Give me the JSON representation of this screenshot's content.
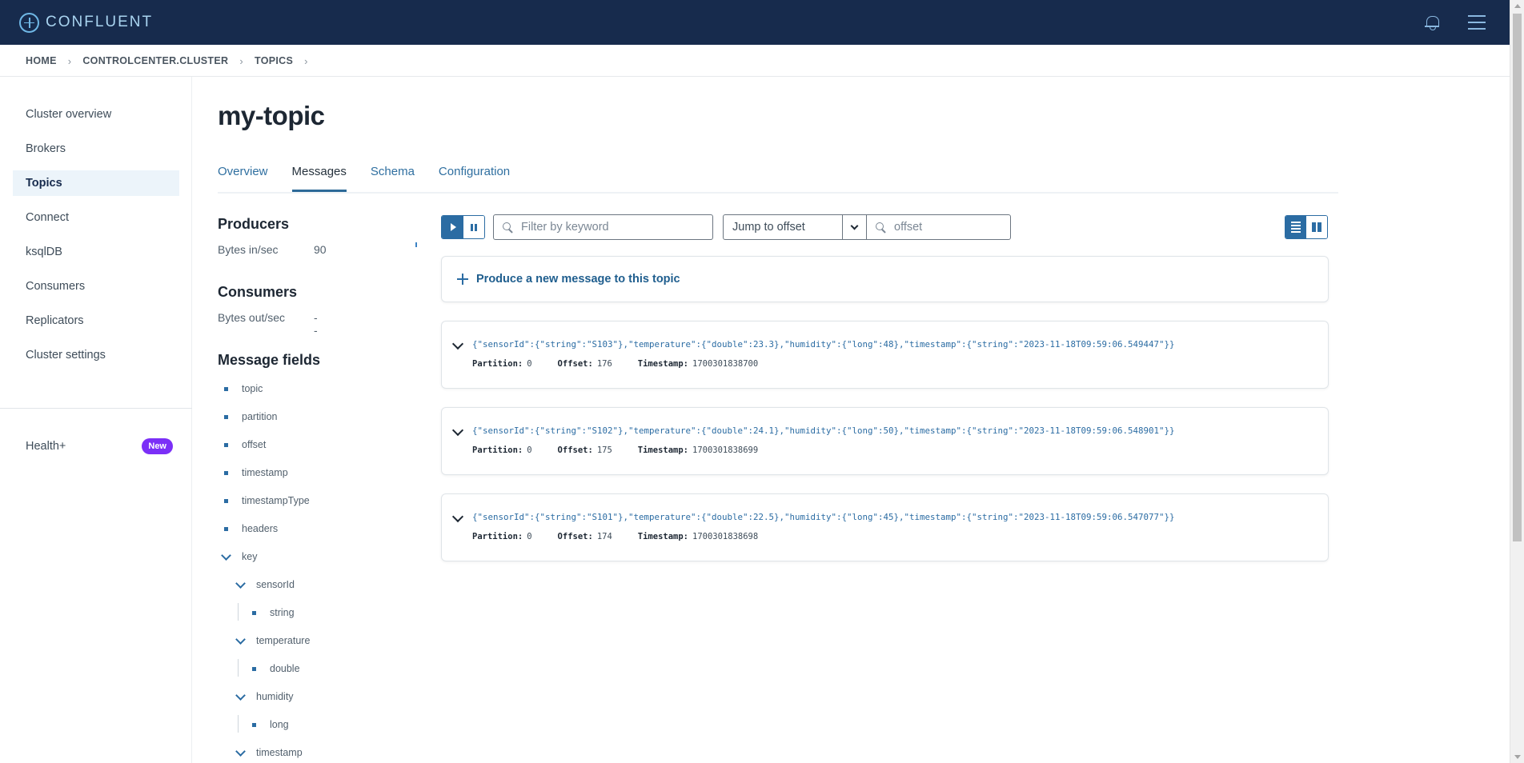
{
  "header": {
    "brand": "CONFLUENT"
  },
  "breadcrumb": [
    "HOME",
    "CONTROLCENTER.CLUSTER",
    "TOPICS"
  ],
  "sidebar": {
    "items": [
      {
        "label": "Cluster overview",
        "active": false
      },
      {
        "label": "Brokers",
        "active": false
      },
      {
        "label": "Topics",
        "active": true
      },
      {
        "label": "Connect",
        "active": false
      },
      {
        "label": "ksqlDB",
        "active": false
      },
      {
        "label": "Consumers",
        "active": false
      },
      {
        "label": "Replicators",
        "active": false
      },
      {
        "label": "Cluster settings",
        "active": false
      }
    ],
    "health_label": "Health+",
    "health_badge": "New"
  },
  "page": {
    "title": "my-topic",
    "tabs": [
      {
        "label": "Overview",
        "active": false
      },
      {
        "label": "Messages",
        "active": true
      },
      {
        "label": "Schema",
        "active": false
      },
      {
        "label": "Configuration",
        "active": false
      }
    ]
  },
  "producers": {
    "heading": "Producers",
    "metric_label": "Bytes in/sec",
    "metric_value": "90"
  },
  "consumers": {
    "heading": "Consumers",
    "metric_label": "Bytes out/sec",
    "metric_value": "--"
  },
  "message_fields": {
    "heading": "Message fields",
    "top_fields": [
      "topic",
      "partition",
      "offset",
      "timestamp",
      "timestampType",
      "headers"
    ],
    "key_label": "key",
    "key_fields": [
      {
        "name": "sensorId",
        "type": "string"
      },
      {
        "name": "temperature",
        "type": "double"
      },
      {
        "name": "humidity",
        "type": "long"
      },
      {
        "name": "timestamp",
        "type": ""
      }
    ]
  },
  "toolbar": {
    "filter_placeholder": "Filter by keyword",
    "jump_select": "Jump to offset",
    "offset_placeholder": "offset"
  },
  "produce": {
    "label": "Produce a new message to this topic"
  },
  "messages": [
    {
      "value": "{\"sensorId\":{\"string\":\"S103\"},\"temperature\":{\"double\":23.3},\"humidity\":{\"long\":48},\"timestamp\":{\"string\":\"2023-11-18T09:59:06.549447\"}}",
      "partition_label": "Partition:",
      "partition": "0",
      "offset_label": "Offset:",
      "offset": "176",
      "timestamp_label": "Timestamp:",
      "timestamp": "1700301838700"
    },
    {
      "value": "{\"sensorId\":{\"string\":\"S102\"},\"temperature\":{\"double\":24.1},\"humidity\":{\"long\":50},\"timestamp\":{\"string\":\"2023-11-18T09:59:06.548901\"}}",
      "partition_label": "Partition:",
      "partition": "0",
      "offset_label": "Offset:",
      "offset": "175",
      "timestamp_label": "Timestamp:",
      "timestamp": "1700301838699"
    },
    {
      "value": "{\"sensorId\":{\"string\":\"S101\"},\"temperature\":{\"double\":22.5},\"humidity\":{\"long\":45},\"timestamp\":{\"string\":\"2023-11-18T09:59:06.547077\"}}",
      "partition_label": "Partition:",
      "partition": "0",
      "offset_label": "Offset:",
      "offset": "174",
      "timestamp_label": "Timestamp:",
      "timestamp": "1700301838698"
    }
  ],
  "colors": {
    "topbar": "#172b4d",
    "accent": "#2b6ca3",
    "badge": "#7b2ff7"
  }
}
